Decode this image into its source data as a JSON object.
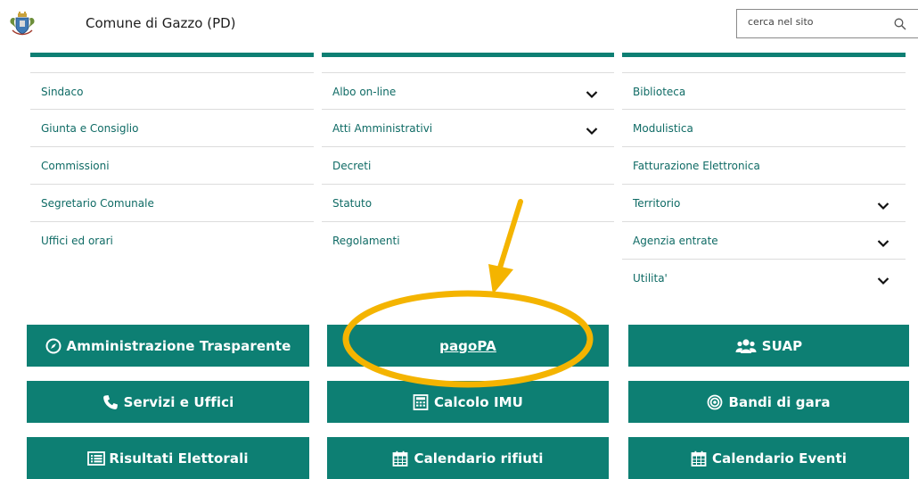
{
  "header": {
    "title": "Comune di Gazzo (PD)",
    "search_placeholder": "cerca nel sito"
  },
  "menu": {
    "col1": [
      {
        "label": "Sindaco"
      },
      {
        "label": "Giunta e Consiglio"
      },
      {
        "label": "Commissioni"
      },
      {
        "label": "Segretario Comunale"
      },
      {
        "label": "Uffici ed orari"
      }
    ],
    "col2": [
      {
        "label": "Albo on-line",
        "expandable": true
      },
      {
        "label": "Atti Amministrativi",
        "expandable": true
      },
      {
        "label": "Decreti"
      },
      {
        "label": "Statuto"
      },
      {
        "label": "Regolamenti"
      }
    ],
    "col3": [
      {
        "label": "Biblioteca"
      },
      {
        "label": "Modulistica"
      },
      {
        "label": "Fatturazione Elettronica"
      },
      {
        "label": "Territorio",
        "expandable": true
      },
      {
        "label": "Agenzia entrate",
        "expandable": true
      },
      {
        "label": "Utilita'",
        "expandable": true
      }
    ]
  },
  "buttons": {
    "amministrazione": "Amministrazione Trasparente",
    "pagopa": "pagoPA",
    "suap": "SUAP",
    "servizi": "Servizi e Uffici",
    "imu": "Calcolo IMU",
    "bandi": "Bandi di gara",
    "risultati": "Risultati Elettorali",
    "rifiuti": "Calendario rifiuti",
    "eventi": "Calendario Eventi"
  },
  "colors": {
    "accent": "#0d7f73",
    "link": "#0f6b65",
    "highlight": "#f4b400"
  },
  "icons": {
    "logo": "municipal-crest-icon",
    "search": "search-icon",
    "chevron": "chevron-down-icon",
    "compass": "compass-icon",
    "users": "users-icon",
    "phone": "phone-icon",
    "calculator": "calculator-icon",
    "target": "bullseye-icon",
    "list": "list-icon",
    "calendar": "calendar-icon"
  }
}
